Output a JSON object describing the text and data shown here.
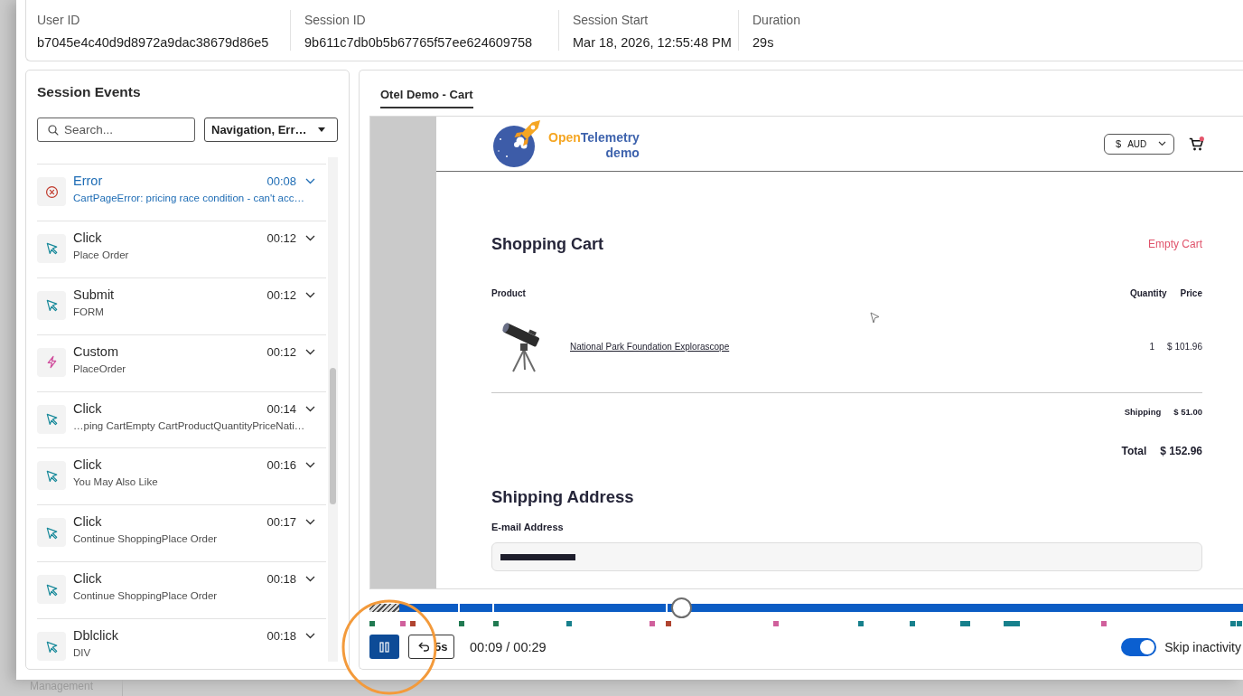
{
  "session_info": [
    {
      "label": "User ID",
      "value": "b7045e4c40d9d8972a9dac38679d86e5"
    },
    {
      "label": "Session ID",
      "value": "9b611c7db0b5b67765f57ee624609758"
    },
    {
      "label": "Session Start",
      "value": "Mar 18, 2026, 12:55:48 PM"
    },
    {
      "label": "Duration",
      "value": "29s"
    }
  ],
  "events_panel": {
    "title": "Session Events",
    "search": {
      "placeholder": "Search..."
    },
    "filter": {
      "value": "Navigation, Err…"
    },
    "events": [
      {
        "kind": "error",
        "title": "Error",
        "time": "00:08",
        "detail": "CartPageError: pricing race condition - can't acc…",
        "selected": true
      },
      {
        "kind": "click",
        "title": "Click",
        "time": "00:12",
        "detail": "Place Order",
        "selected": false
      },
      {
        "kind": "click",
        "title": "Submit",
        "time": "00:12",
        "detail": "FORM",
        "selected": false
      },
      {
        "kind": "custom",
        "title": "Custom",
        "time": "00:12",
        "detail": "PlaceOrder",
        "selected": false
      },
      {
        "kind": "click",
        "title": "Click",
        "time": "00:14",
        "detail": "…ping CartEmpty CartProductQuantityPriceNati…",
        "selected": false
      },
      {
        "kind": "click",
        "title": "Click",
        "time": "00:16",
        "detail": "You May Also Like",
        "selected": false
      },
      {
        "kind": "click",
        "title": "Click",
        "time": "00:17",
        "detail": "Continue ShoppingPlace Order",
        "selected": false
      },
      {
        "kind": "click",
        "title": "Click",
        "time": "00:18",
        "detail": "Continue ShoppingPlace Order",
        "selected": false
      },
      {
        "kind": "click",
        "title": "Dblclick",
        "time": "00:18",
        "detail": "DIV",
        "selected": false
      }
    ]
  },
  "replay": {
    "tabs": [
      {
        "label": "Otel Demo - Cart",
        "selected": true
      }
    ],
    "page": {
      "logo": {
        "wordmark": [
          {
            "text": "Open",
            "color": "#f5a623"
          },
          {
            "text": "Telemetry",
            "color": "#3e63ad"
          }
        ],
        "tagline": "demo"
      },
      "currency": {
        "symbol": "$",
        "value": "AUD"
      },
      "heading": "Shopping Cart",
      "empty_cart": "Empty Cart",
      "columns": [
        "Product",
        "Quantity",
        "Price"
      ],
      "items": [
        {
          "product": "National Park Foundation Explorascope",
          "quantity": "1",
          "price": "$ 101.96"
        }
      ],
      "summary": [
        {
          "kind": "shipping",
          "label": "Shipping",
          "value": "$ 51.00"
        },
        {
          "kind": "total",
          "label": "Total",
          "value": "$ 152.96"
        }
      ],
      "section_heading": "Shipping Address",
      "email": {
        "label": "E-mail Address",
        "masked": true
      }
    },
    "timeline": {
      "level": 0.357,
      "inactive": {
        "level": 0.034
      },
      "dividers": [
        {
          "level": 0.101
        },
        {
          "level": 0.141
        },
        {
          "level": 0.339
        }
      ],
      "markers": [
        {
          "level": 0.0,
          "color": "#217a52"
        },
        {
          "level": 0.035,
          "color": "#d0609c"
        },
        {
          "level": 0.047,
          "color": "#b04430"
        },
        {
          "level": 0.102,
          "color": "#217a52"
        },
        {
          "level": 0.142,
          "color": "#217a52"
        },
        {
          "level": 0.225,
          "color": "#17808c"
        },
        {
          "level": 0.321,
          "color": "#d0609c"
        },
        {
          "level": 0.339,
          "color": "#b04430"
        },
        {
          "level": 0.462,
          "color": "#d0609c"
        },
        {
          "level": 0.559,
          "color": "#17808c"
        },
        {
          "level": 0.618,
          "color": "#17808c"
        },
        {
          "level": 0.676,
          "color": "#17808c"
        },
        {
          "level": 0.682,
          "color": "#17808c"
        },
        {
          "level": 0.726,
          "color": "#17808c"
        },
        {
          "level": 0.732,
          "color": "#17808c"
        },
        {
          "level": 0.738,
          "color": "#17808c"
        },
        {
          "level": 0.838,
          "color": "#d0609c"
        },
        {
          "level": 0.986,
          "color": "#17808c"
        },
        {
          "level": 0.993,
          "color": "#17808c"
        }
      ]
    },
    "controls": {
      "playing": true,
      "highlighted": true,
      "rewind": "5s",
      "time": "00:09 / 00:29",
      "skip_inactivity": {
        "label": "Skip inactivity",
        "on": true
      }
    }
  },
  "background": {
    "sidebar_item": "Management"
  }
}
